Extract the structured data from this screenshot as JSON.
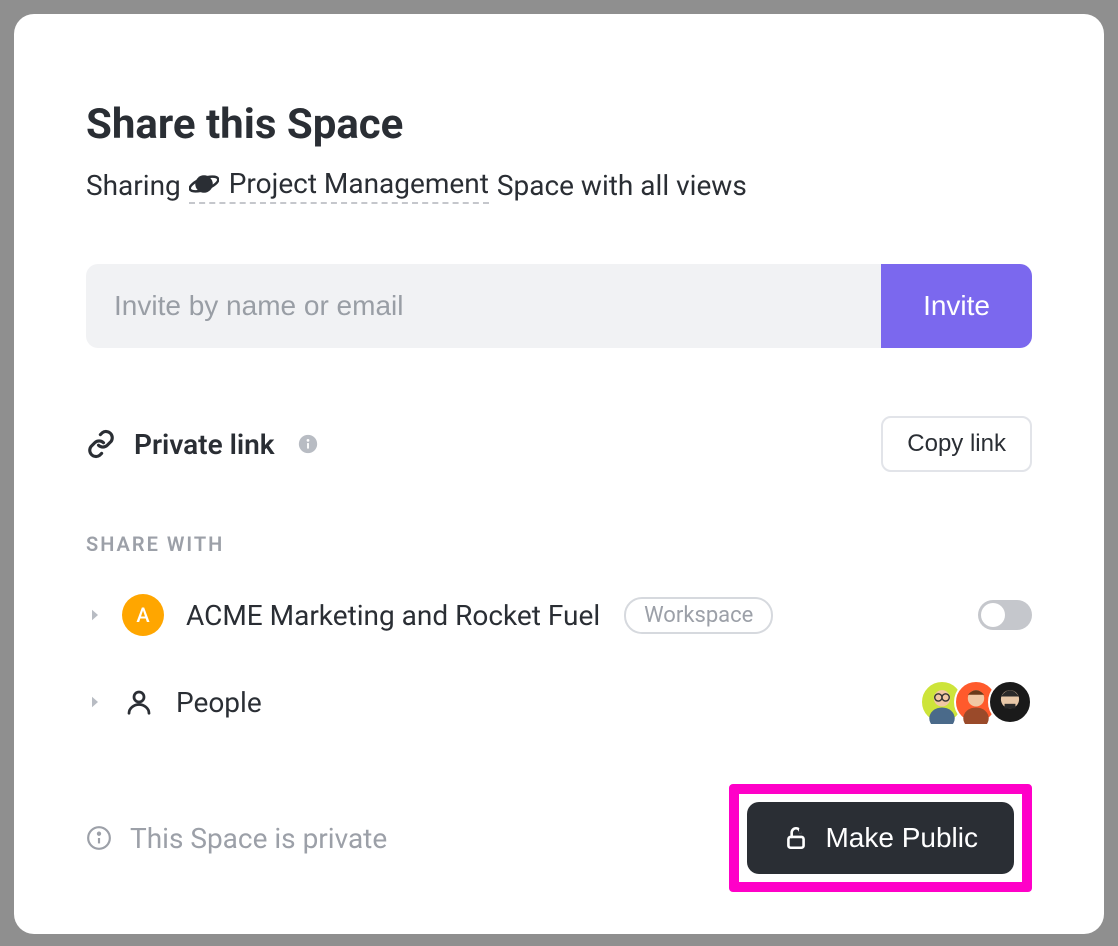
{
  "modal": {
    "title": "Share this Space",
    "subtitle_prefix": "Sharing",
    "space_name": "Project Management",
    "subtitle_suffix": "Space with all views"
  },
  "invite": {
    "placeholder": "Invite by name or email",
    "button_label": "Invite"
  },
  "private_link": {
    "label": "Private link",
    "copy_button": "Copy link"
  },
  "share_with": {
    "section_label": "SHARE WITH",
    "workspace": {
      "avatar_letter": "A",
      "name": "ACME Marketing and Rocket Fuel",
      "badge": "Workspace",
      "toggle_on": false
    },
    "people": {
      "label": "People",
      "avatars": [
        {
          "bg": "#cde43a",
          "face": "#f1c7a3"
        },
        {
          "bg": "#ff5a2c",
          "face": "#f1c7a3"
        },
        {
          "bg": "#1a1a1a",
          "face": "#e8c8a8"
        }
      ]
    }
  },
  "footer": {
    "private_text": "This Space is private",
    "make_public_label": "Make Public"
  },
  "colors": {
    "accent": "#7b68ee",
    "highlight": "#ff00c8"
  }
}
